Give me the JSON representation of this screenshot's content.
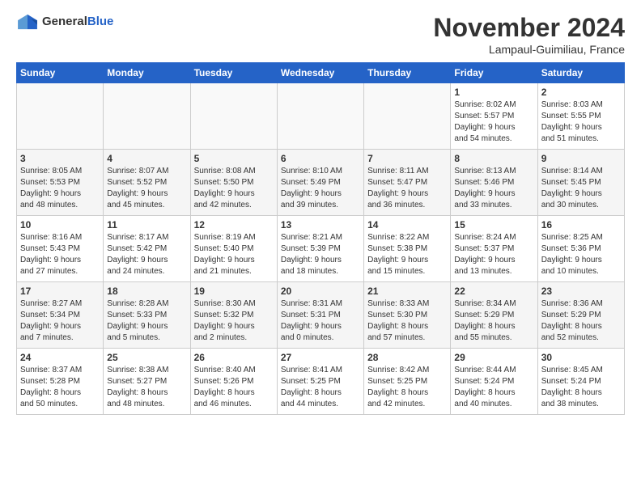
{
  "header": {
    "logo_general": "General",
    "logo_blue": "Blue",
    "month_title": "November 2024",
    "location": "Lampaul-Guimiliau, France"
  },
  "weekdays": [
    "Sunday",
    "Monday",
    "Tuesday",
    "Wednesday",
    "Thursday",
    "Friday",
    "Saturday"
  ],
  "weeks": [
    [
      {
        "day": "",
        "info": ""
      },
      {
        "day": "",
        "info": ""
      },
      {
        "day": "",
        "info": ""
      },
      {
        "day": "",
        "info": ""
      },
      {
        "day": "",
        "info": ""
      },
      {
        "day": "1",
        "info": "Sunrise: 8:02 AM\nSunset: 5:57 PM\nDaylight: 9 hours\nand 54 minutes."
      },
      {
        "day": "2",
        "info": "Sunrise: 8:03 AM\nSunset: 5:55 PM\nDaylight: 9 hours\nand 51 minutes."
      }
    ],
    [
      {
        "day": "3",
        "info": "Sunrise: 8:05 AM\nSunset: 5:53 PM\nDaylight: 9 hours\nand 48 minutes."
      },
      {
        "day": "4",
        "info": "Sunrise: 8:07 AM\nSunset: 5:52 PM\nDaylight: 9 hours\nand 45 minutes."
      },
      {
        "day": "5",
        "info": "Sunrise: 8:08 AM\nSunset: 5:50 PM\nDaylight: 9 hours\nand 42 minutes."
      },
      {
        "day": "6",
        "info": "Sunrise: 8:10 AM\nSunset: 5:49 PM\nDaylight: 9 hours\nand 39 minutes."
      },
      {
        "day": "7",
        "info": "Sunrise: 8:11 AM\nSunset: 5:47 PM\nDaylight: 9 hours\nand 36 minutes."
      },
      {
        "day": "8",
        "info": "Sunrise: 8:13 AM\nSunset: 5:46 PM\nDaylight: 9 hours\nand 33 minutes."
      },
      {
        "day": "9",
        "info": "Sunrise: 8:14 AM\nSunset: 5:45 PM\nDaylight: 9 hours\nand 30 minutes."
      }
    ],
    [
      {
        "day": "10",
        "info": "Sunrise: 8:16 AM\nSunset: 5:43 PM\nDaylight: 9 hours\nand 27 minutes."
      },
      {
        "day": "11",
        "info": "Sunrise: 8:17 AM\nSunset: 5:42 PM\nDaylight: 9 hours\nand 24 minutes."
      },
      {
        "day": "12",
        "info": "Sunrise: 8:19 AM\nSunset: 5:40 PM\nDaylight: 9 hours\nand 21 minutes."
      },
      {
        "day": "13",
        "info": "Sunrise: 8:21 AM\nSunset: 5:39 PM\nDaylight: 9 hours\nand 18 minutes."
      },
      {
        "day": "14",
        "info": "Sunrise: 8:22 AM\nSunset: 5:38 PM\nDaylight: 9 hours\nand 15 minutes."
      },
      {
        "day": "15",
        "info": "Sunrise: 8:24 AM\nSunset: 5:37 PM\nDaylight: 9 hours\nand 13 minutes."
      },
      {
        "day": "16",
        "info": "Sunrise: 8:25 AM\nSunset: 5:36 PM\nDaylight: 9 hours\nand 10 minutes."
      }
    ],
    [
      {
        "day": "17",
        "info": "Sunrise: 8:27 AM\nSunset: 5:34 PM\nDaylight: 9 hours\nand 7 minutes."
      },
      {
        "day": "18",
        "info": "Sunrise: 8:28 AM\nSunset: 5:33 PM\nDaylight: 9 hours\nand 5 minutes."
      },
      {
        "day": "19",
        "info": "Sunrise: 8:30 AM\nSunset: 5:32 PM\nDaylight: 9 hours\nand 2 minutes."
      },
      {
        "day": "20",
        "info": "Sunrise: 8:31 AM\nSunset: 5:31 PM\nDaylight: 9 hours\nand 0 minutes."
      },
      {
        "day": "21",
        "info": "Sunrise: 8:33 AM\nSunset: 5:30 PM\nDaylight: 8 hours\nand 57 minutes."
      },
      {
        "day": "22",
        "info": "Sunrise: 8:34 AM\nSunset: 5:29 PM\nDaylight: 8 hours\nand 55 minutes."
      },
      {
        "day": "23",
        "info": "Sunrise: 8:36 AM\nSunset: 5:29 PM\nDaylight: 8 hours\nand 52 minutes."
      }
    ],
    [
      {
        "day": "24",
        "info": "Sunrise: 8:37 AM\nSunset: 5:28 PM\nDaylight: 8 hours\nand 50 minutes."
      },
      {
        "day": "25",
        "info": "Sunrise: 8:38 AM\nSunset: 5:27 PM\nDaylight: 8 hours\nand 48 minutes."
      },
      {
        "day": "26",
        "info": "Sunrise: 8:40 AM\nSunset: 5:26 PM\nDaylight: 8 hours\nand 46 minutes."
      },
      {
        "day": "27",
        "info": "Sunrise: 8:41 AM\nSunset: 5:25 PM\nDaylight: 8 hours\nand 44 minutes."
      },
      {
        "day": "28",
        "info": "Sunrise: 8:42 AM\nSunset: 5:25 PM\nDaylight: 8 hours\nand 42 minutes."
      },
      {
        "day": "29",
        "info": "Sunrise: 8:44 AM\nSunset: 5:24 PM\nDaylight: 8 hours\nand 40 minutes."
      },
      {
        "day": "30",
        "info": "Sunrise: 8:45 AM\nSunset: 5:24 PM\nDaylight: 8 hours\nand 38 minutes."
      }
    ]
  ]
}
